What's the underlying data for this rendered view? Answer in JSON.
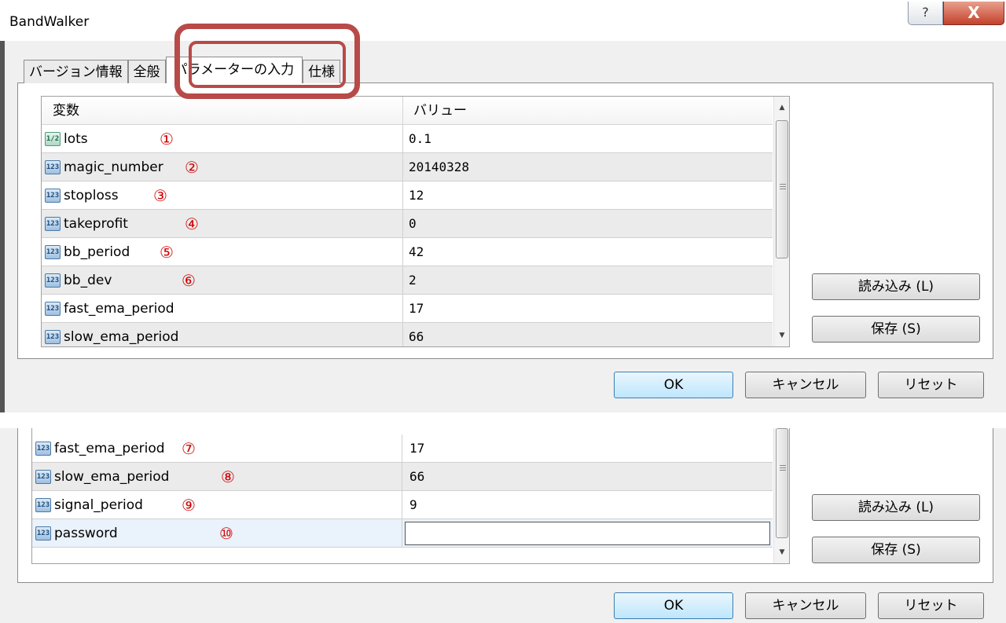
{
  "window": {
    "title": "BandWalker",
    "help_glyph": "?",
    "close_glyph": "X"
  },
  "tabs": [
    {
      "label": "バージョン情報"
    },
    {
      "label": "全般"
    },
    {
      "label": "パラメーターの入力"
    },
    {
      "label": "仕様"
    }
  ],
  "grid": {
    "col_variable": "変数",
    "col_value": "バリュー"
  },
  "params_top": [
    {
      "type": "1/2",
      "name": "lots",
      "marker": "①",
      "value": "0.1"
    },
    {
      "type": "123",
      "name": "magic_number",
      "marker": "②",
      "value": "20140328"
    },
    {
      "type": "123",
      "name": "stoploss",
      "marker": "③",
      "value": "12"
    },
    {
      "type": "123",
      "name": "takeprofit",
      "marker": "④",
      "value": "0"
    },
    {
      "type": "123",
      "name": "bb_period",
      "marker": "⑤",
      "value": "42"
    },
    {
      "type": "123",
      "name": "bb_dev",
      "marker": "⑥",
      "value": "2"
    },
    {
      "type": "123",
      "name": "fast_ema_period",
      "marker": "",
      "value": "17"
    },
    {
      "type": "123",
      "name": "slow_ema_period",
      "marker": "",
      "value": "66"
    }
  ],
  "params_bottom": [
    {
      "type": "123",
      "name": "fast_ema_period",
      "marker": "⑦",
      "value": "17"
    },
    {
      "type": "123",
      "name": "slow_ema_period",
      "marker": "⑧",
      "value": "66"
    },
    {
      "type": "123",
      "name": "signal_period",
      "marker": "⑨",
      "value": "9"
    },
    {
      "type": "123",
      "name": "password",
      "marker": "⑩",
      "value": ""
    }
  ],
  "buttons": {
    "load": "読み込み (L)",
    "save": "保存 (S)",
    "ok": "OK",
    "cancel": "キャンセル",
    "reset": "リセット"
  },
  "colors": {
    "annotation": "#b84a48",
    "marker": "#d10000"
  }
}
